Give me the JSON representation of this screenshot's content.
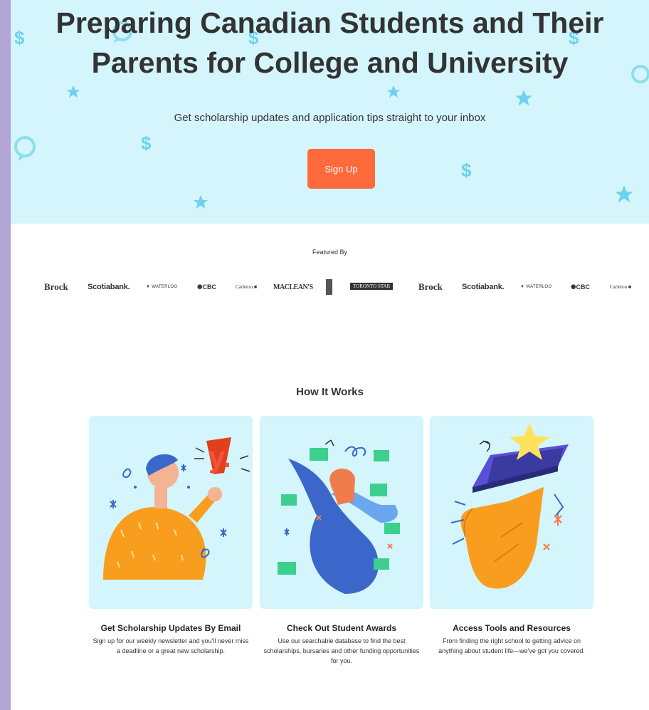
{
  "hero": {
    "title_line1": "Preparing Canadian Students and Their",
    "title_line2": "Parents for College and University",
    "subtitle": "Get scholarship updates and application tips straight to your inbox",
    "signup_label": "Sign Up",
    "decor_glyph": "$"
  },
  "featured": {
    "label": "Featured By",
    "logos": {
      "brock": "Brock",
      "scotiabank": "Scotiabank.",
      "waterloo": "WATERLOO",
      "cbc": "CBC",
      "carleton": "Carleton",
      "macleans": "MACLEAN'S",
      "toronto_star": "TORONTO STAR"
    }
  },
  "how_it_works": {
    "title": "How It Works",
    "cards": [
      {
        "title": "Get Scholarship Updates By Email",
        "text": "Sign up for our weekly newsletter and you'll never miss a deadline or a great new scholarship."
      },
      {
        "title": "Check Out Student Awards",
        "text": "Use our searchable database to find the best scholarships, bursaries and other funding opportunities for you."
      },
      {
        "title": "Access Tools and Resources",
        "text": "From finding the right school to getting advice on anything about student life—we've got you covered."
      }
    ]
  },
  "colors": {
    "hero_bg": "#d3f5fb",
    "accent": "#ff6a3d",
    "frame": "#b3a4d6"
  }
}
